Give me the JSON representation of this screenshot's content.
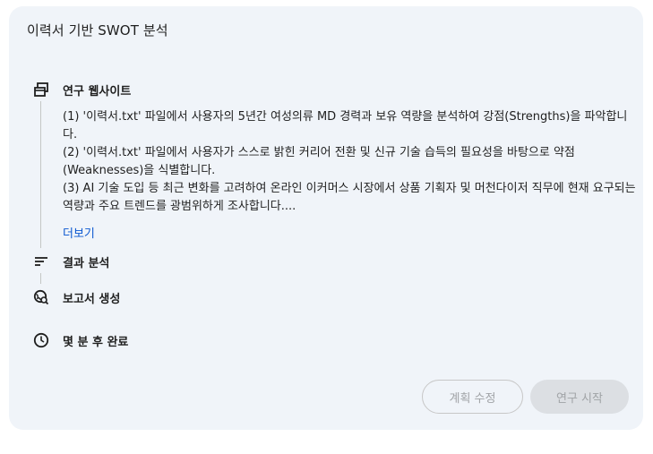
{
  "card": {
    "title": "이력서 기반 SWOT 분석"
  },
  "steps": [
    {
      "label": "연구 웹사이트",
      "icon": "browser-windows-icon"
    },
    {
      "label": "결과 분석",
      "icon": "sort-lines-icon"
    },
    {
      "label": "보고서 생성",
      "icon": "globe-search-icon"
    },
    {
      "label": "몇 분 후 완료",
      "icon": "clock-icon"
    }
  ],
  "plan": {
    "lines": [
      "(1) '이력서.txt' 파일에서 사용자의 5년간 여성의류 MD 경력과 보유 역량을 분석하여 강점(Strengths)을 파악합니다.",
      "(2) '이력서.txt' 파일에서 사용자가 스스로 밝힌 커리어 전환 및 신규 기술 습득의 필요성을 바탕으로 약점(Weaknesses)을 식별합니다.",
      "(3) AI 기술 도입 등 최근 변화를 고려하여 온라인 이커머스 시장에서 상품 기획자 및 머천다이저 직무에 현재 요구되는 역량과 주요 트렌드를 광범위하게 조사합니다...."
    ],
    "more_label": "더보기"
  },
  "actions": {
    "edit_plan_label": "계획 수정",
    "start_research_label": "연구 시작"
  }
}
